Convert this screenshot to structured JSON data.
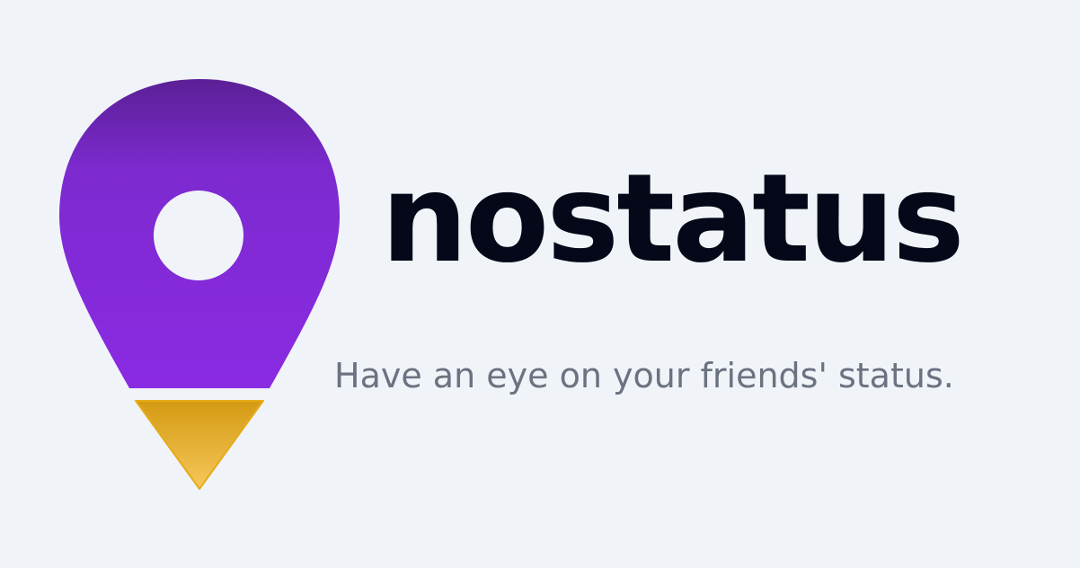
{
  "brand": {
    "name": "nostatus",
    "tagline": "Have an eye on your friends' status.",
    "logo_icon": "location-pin-icon"
  },
  "colors": {
    "background": "#f0f4f9",
    "pin_purple": "#8a2be2",
    "pin_purple_dark": "#5b2096",
    "pin_tip_gold": "#e5ac1a",
    "wordmark": "#050818",
    "tagline": "#6b7280",
    "pin_hole": "#f0f4f9"
  }
}
